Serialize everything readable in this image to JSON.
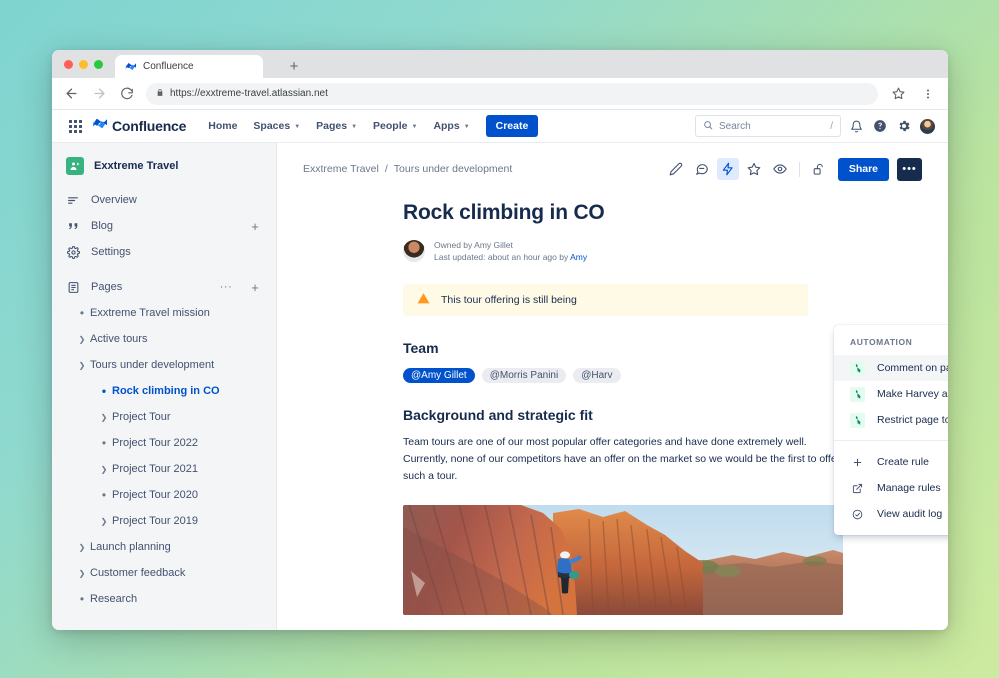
{
  "browser": {
    "tab": {
      "title": "Confluence",
      "favicon": "confluence-icon"
    },
    "new_tab_label": "+",
    "url": "https://exxtreme-travel.atlassian.net",
    "lock_icon": "lock-icon",
    "back_icon": "back-arrow-icon",
    "forward_icon": "forward-arrow-icon",
    "reload_icon": "reload-icon",
    "bookmark_icon": "star-icon",
    "menu_icon": "kebab-menu-icon"
  },
  "topnav": {
    "app_switcher": "app-switcher-icon",
    "brand": "Confluence",
    "items": [
      {
        "label": "Home",
        "has_caret": false
      },
      {
        "label": "Spaces",
        "has_caret": true
      },
      {
        "label": "Pages",
        "has_caret": true
      },
      {
        "label": "People",
        "has_caret": true
      },
      {
        "label": "Apps",
        "has_caret": true
      }
    ],
    "create_label": "Create",
    "search": {
      "placeholder": "Search",
      "shortcut": "/",
      "icon": "search-icon"
    },
    "notifications_icon": "bell-icon",
    "help_icon": "question-circle-icon",
    "settings_icon": "gear-icon",
    "profile": "user-avatar"
  },
  "sidebar": {
    "space": {
      "name": "Exxtreme Travel",
      "logo": "space-logo"
    },
    "nav": [
      {
        "label": "Overview",
        "icon": "overview-icon",
        "add": false
      },
      {
        "label": "Blog",
        "icon": "blog-quote-icon",
        "add": true
      },
      {
        "label": "Settings",
        "icon": "gear-icon",
        "add": false
      }
    ],
    "pages": {
      "label": "Pages",
      "icon": "pages-icon",
      "dots": "···",
      "plus": "+"
    },
    "tree": [
      {
        "label": "Exxtreme Travel mission",
        "indent": 0,
        "marker": "bullet",
        "active": false
      },
      {
        "label": "Active tours",
        "indent": 0,
        "marker": "chevron-right",
        "active": false
      },
      {
        "label": "Tours under development",
        "indent": 0,
        "marker": "chevron-down",
        "active": false
      },
      {
        "label": "Rock climbing in CO",
        "indent": 1,
        "marker": "bullet",
        "active": true
      },
      {
        "label": "Project Tour",
        "indent": 1,
        "marker": "chevron-right",
        "active": false
      },
      {
        "label": "Project Tour 2022",
        "indent": 1,
        "marker": "bullet",
        "active": false
      },
      {
        "label": "Project Tour 2021",
        "indent": 1,
        "marker": "chevron-right",
        "active": false
      },
      {
        "label": "Project Tour 2020",
        "indent": 1,
        "marker": "bullet",
        "active": false
      },
      {
        "label": "Project Tour 2019",
        "indent": 1,
        "marker": "chevron-right",
        "active": false
      },
      {
        "label": "Launch planning",
        "indent": 0,
        "marker": "chevron-right",
        "active": false
      },
      {
        "label": "Customer feedback",
        "indent": 0,
        "marker": "chevron-right",
        "active": false
      },
      {
        "label": "Research",
        "indent": 0,
        "marker": "bullet",
        "active": false
      }
    ]
  },
  "breadcrumb": {
    "space": "Exxtreme Travel",
    "sep": "/",
    "parent": "Tours under development"
  },
  "page_actions": {
    "edit_icon": "pencil-icon",
    "comment_icon": "comment-icon",
    "automation_icon": "lightning-bolt-icon",
    "star_icon": "star-outline-icon",
    "watch_icon": "eye-icon",
    "restrictions_icon": "unlocked-padlock-icon",
    "share_label": "Share",
    "more_label": "•••"
  },
  "page": {
    "title": "Rock climbing in CO",
    "owned_by": "Owned by Amy Gillet",
    "last_updated_prefix": "Last updated: about an hour ago by ",
    "last_updated_author": "Amy",
    "warning": "This tour offering is still being",
    "warning_icon": "warning-triangle-icon",
    "team_heading": "Team",
    "mentions": [
      {
        "text": "@Amy Gillet",
        "style": "me"
      },
      {
        "text": "@Morris Panini",
        "style": "other"
      },
      {
        "text": "@Harv",
        "style": "other"
      }
    ],
    "section_heading": "Background and strategic fit",
    "paragraph": "Team tours are one of our most popular offer categories and have done extremely well. Currently, none of our competitors have an offer on the market so we would be the first to offer such a tour.",
    "image_alt": "rock-climber-on-red-sandstone-canyon-wall"
  },
  "automation_menu": {
    "heading": "AUTOMATION",
    "rules": [
      {
        "label": "Comment on page",
        "icon": "automation-rule-icon",
        "hovered": true
      },
      {
        "label": "Make Harvey a page watcher",
        "icon": "automation-rule-icon",
        "hovered": false
      },
      {
        "label": "Restrict page to project leads",
        "icon": "automation-rule-icon",
        "hovered": false
      }
    ],
    "actions": [
      {
        "label": "Create rule",
        "icon": "plus-icon"
      },
      {
        "label": "Manage rules",
        "icon": "external-link-icon"
      },
      {
        "label": "View audit log",
        "icon": "check-circle-icon"
      }
    ]
  },
  "colors": {
    "accent_blue": "#0052CC",
    "link_blue": "#0052CC",
    "sidebar_bg": "#F4F5F7",
    "warning_bg": "#FFFAE6",
    "warning_icon": "#FF991F",
    "dark_button": "#172B4D",
    "automation_chip_bg": "#E3FCEF",
    "space_logo_green": "#36B37E"
  }
}
